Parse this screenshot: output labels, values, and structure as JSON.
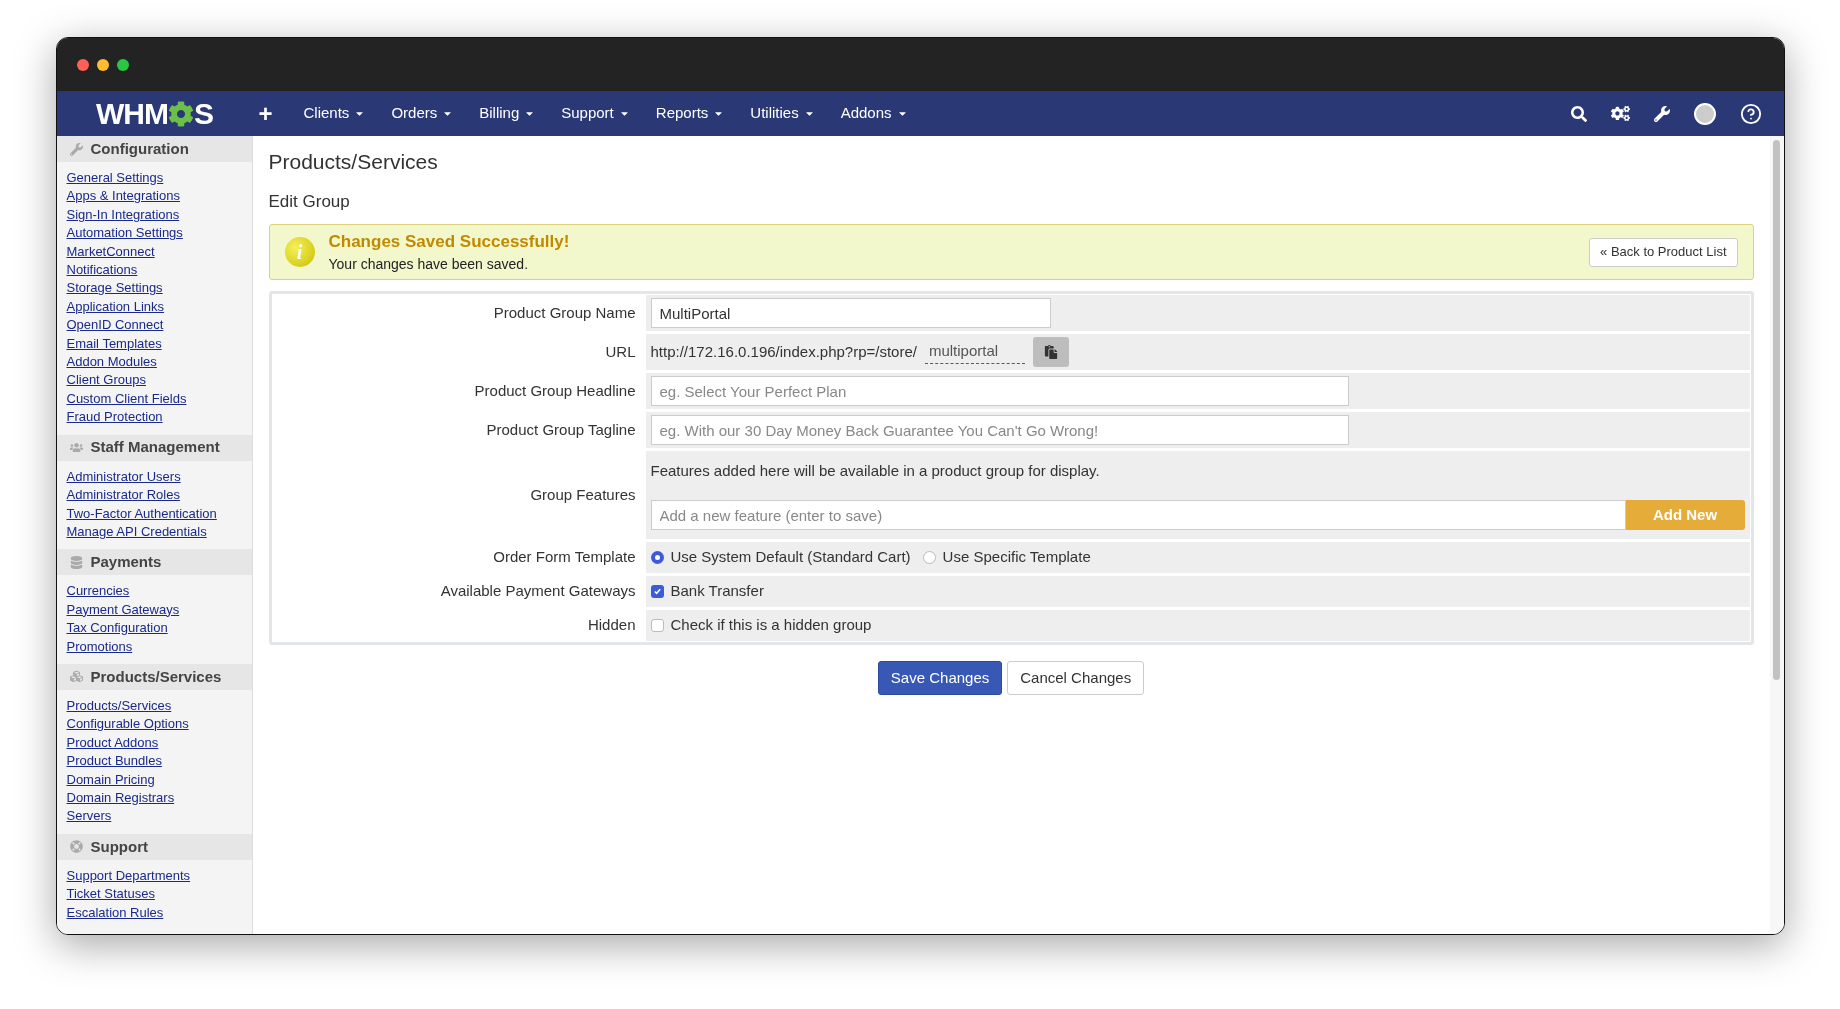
{
  "window": {
    "controls": [
      {
        "color": "#ff5f57"
      },
      {
        "color": "#febc2e"
      },
      {
        "color": "#28c840"
      }
    ]
  },
  "navbar": {
    "logo": {
      "before": "WHM",
      "after": "S"
    },
    "add": "+",
    "menu": [
      {
        "label": "Clients"
      },
      {
        "label": "Orders"
      },
      {
        "label": "Billing"
      },
      {
        "label": "Support"
      },
      {
        "label": "Reports"
      },
      {
        "label": "Utilities"
      },
      {
        "label": "Addons"
      }
    ]
  },
  "sidebar": {
    "sections": [
      {
        "title": "Configuration",
        "kind": "wrench",
        "links": [
          "General Settings",
          "Apps & Integrations",
          "Sign-In Integrations",
          "Automation Settings",
          "MarketConnect",
          "Notifications",
          "Storage Settings",
          "Application Links",
          "OpenID Connect",
          "Email Templates",
          "Addon Modules",
          "Client Groups",
          "Custom Client Fields",
          "Fraud Protection"
        ]
      },
      {
        "title": "Staff Management",
        "kind": "users",
        "links": [
          "Administrator Users",
          "Administrator Roles",
          "Two-Factor Authentication",
          "Manage API Credentials"
        ]
      },
      {
        "title": "Payments",
        "kind": "coins",
        "links": [
          "Currencies",
          "Payment Gateways",
          "Tax Configuration",
          "Promotions"
        ]
      },
      {
        "title": "Products/Services",
        "kind": "cubes",
        "links": [
          "Products/Services",
          "Configurable Options",
          "Product Addons",
          "Product Bundles",
          "Domain Pricing",
          "Domain Registrars",
          "Servers"
        ]
      },
      {
        "title": "Support",
        "kind": "lifering",
        "links": [
          "Support Departments",
          "Ticket Statuses",
          "Escalation Rules"
        ]
      }
    ]
  },
  "page": {
    "title": "Products/Services",
    "subtitle": "Edit Group"
  },
  "alert": {
    "icon": "i",
    "title": "Changes Saved Successfully!",
    "message": "Your changes have been saved.",
    "button": "« Back to Product List"
  },
  "form": {
    "rows": [
      {
        "kind": "text",
        "label": "Product Group Name",
        "value": "MultiPortal"
      },
      {
        "kind": "url",
        "label": "URL",
        "prefix": "http://172.16.0.196/index.php?rp=/store/",
        "slug": "multiportal"
      },
      {
        "kind": "wide",
        "label": "Product Group Headline",
        "placeholder": "eg. Select Your Perfect Plan"
      },
      {
        "kind": "wide",
        "label": "Product Group Tagline",
        "placeholder": "eg. With our 30 Day Money Back Guarantee You Can't Go Wrong!"
      },
      {
        "kind": "features",
        "label": "Group Features",
        "note": "Features added here will be available in a product group for display.",
        "placeholder": "Add a new feature (enter to save)",
        "button": "Add New"
      },
      {
        "kind": "radios",
        "label": "Order Form Template",
        "options": [
          {
            "label": "Use System Default (Standard Cart)",
            "selected": true
          },
          {
            "label": "Use Specific Template",
            "selected": false
          }
        ]
      },
      {
        "kind": "checkboxes",
        "label": "Available Payment Gateways",
        "options": [
          {
            "label": "Bank Transfer",
            "checked": true
          }
        ]
      },
      {
        "kind": "checkboxes",
        "label": "Hidden",
        "options": [
          {
            "label": "Check if this is a hidden group",
            "checked": false
          }
        ]
      }
    ]
  },
  "buttons": [
    {
      "label": "Save Changes",
      "kind": "primary"
    },
    {
      "label": "Cancel Changes",
      "kind": "default"
    }
  ]
}
